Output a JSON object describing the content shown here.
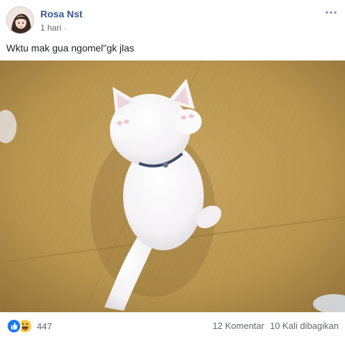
{
  "post": {
    "author": "Rosa Nst",
    "time": "1 hari",
    "caption": "Wktu mak gua ngomel\"gk jlas",
    "photo_icon": "cat-photo",
    "reactions": {
      "icons": [
        "like-icon",
        "haha-icon"
      ],
      "count": "447"
    },
    "comments": "12 Komentar",
    "shares": "10 Kali dibagikan"
  },
  "colors": {
    "author_link": "#385898",
    "like_blue": "#1877f2",
    "haha_yellow": "#f7c94b",
    "meta_gray": "#606770"
  }
}
